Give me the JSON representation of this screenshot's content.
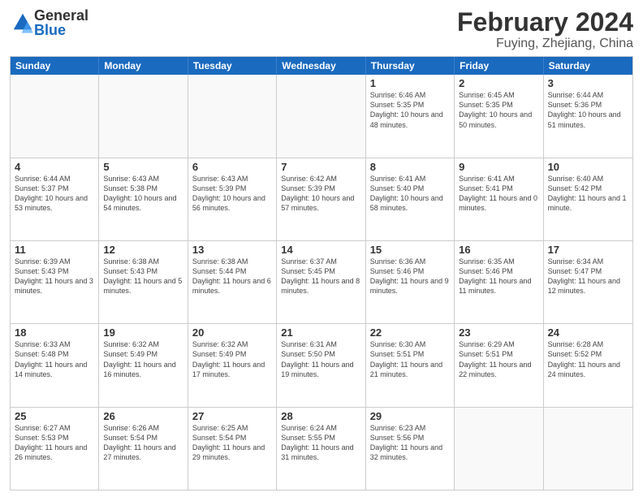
{
  "header": {
    "logo": {
      "general": "General",
      "blue": "Blue"
    },
    "title": "February 2024",
    "location": "Fuying, Zhejiang, China"
  },
  "weekdays": [
    "Sunday",
    "Monday",
    "Tuesday",
    "Wednesday",
    "Thursday",
    "Friday",
    "Saturday"
  ],
  "rows": [
    [
      {
        "day": "",
        "info": ""
      },
      {
        "day": "",
        "info": ""
      },
      {
        "day": "",
        "info": ""
      },
      {
        "day": "",
        "info": ""
      },
      {
        "day": "1",
        "info": "Sunrise: 6:46 AM\nSunset: 5:35 PM\nDaylight: 10 hours\nand 48 minutes."
      },
      {
        "day": "2",
        "info": "Sunrise: 6:45 AM\nSunset: 5:35 PM\nDaylight: 10 hours\nand 50 minutes."
      },
      {
        "day": "3",
        "info": "Sunrise: 6:44 AM\nSunset: 5:36 PM\nDaylight: 10 hours\nand 51 minutes."
      }
    ],
    [
      {
        "day": "4",
        "info": "Sunrise: 6:44 AM\nSunset: 5:37 PM\nDaylight: 10 hours\nand 53 minutes."
      },
      {
        "day": "5",
        "info": "Sunrise: 6:43 AM\nSunset: 5:38 PM\nDaylight: 10 hours\nand 54 minutes."
      },
      {
        "day": "6",
        "info": "Sunrise: 6:43 AM\nSunset: 5:39 PM\nDaylight: 10 hours\nand 56 minutes."
      },
      {
        "day": "7",
        "info": "Sunrise: 6:42 AM\nSunset: 5:39 PM\nDaylight: 10 hours\nand 57 minutes."
      },
      {
        "day": "8",
        "info": "Sunrise: 6:41 AM\nSunset: 5:40 PM\nDaylight: 10 hours\nand 58 minutes."
      },
      {
        "day": "9",
        "info": "Sunrise: 6:41 AM\nSunset: 5:41 PM\nDaylight: 11 hours\nand 0 minutes."
      },
      {
        "day": "10",
        "info": "Sunrise: 6:40 AM\nSunset: 5:42 PM\nDaylight: 11 hours\nand 1 minute."
      }
    ],
    [
      {
        "day": "11",
        "info": "Sunrise: 6:39 AM\nSunset: 5:43 PM\nDaylight: 11 hours\nand 3 minutes."
      },
      {
        "day": "12",
        "info": "Sunrise: 6:38 AM\nSunset: 5:43 PM\nDaylight: 11 hours\nand 5 minutes."
      },
      {
        "day": "13",
        "info": "Sunrise: 6:38 AM\nSunset: 5:44 PM\nDaylight: 11 hours\nand 6 minutes."
      },
      {
        "day": "14",
        "info": "Sunrise: 6:37 AM\nSunset: 5:45 PM\nDaylight: 11 hours\nand 8 minutes."
      },
      {
        "day": "15",
        "info": "Sunrise: 6:36 AM\nSunset: 5:46 PM\nDaylight: 11 hours\nand 9 minutes."
      },
      {
        "day": "16",
        "info": "Sunrise: 6:35 AM\nSunset: 5:46 PM\nDaylight: 11 hours\nand 11 minutes."
      },
      {
        "day": "17",
        "info": "Sunrise: 6:34 AM\nSunset: 5:47 PM\nDaylight: 11 hours\nand 12 minutes."
      }
    ],
    [
      {
        "day": "18",
        "info": "Sunrise: 6:33 AM\nSunset: 5:48 PM\nDaylight: 11 hours\nand 14 minutes."
      },
      {
        "day": "19",
        "info": "Sunrise: 6:32 AM\nSunset: 5:49 PM\nDaylight: 11 hours\nand 16 minutes."
      },
      {
        "day": "20",
        "info": "Sunrise: 6:32 AM\nSunset: 5:49 PM\nDaylight: 11 hours\nand 17 minutes."
      },
      {
        "day": "21",
        "info": "Sunrise: 6:31 AM\nSunset: 5:50 PM\nDaylight: 11 hours\nand 19 minutes."
      },
      {
        "day": "22",
        "info": "Sunrise: 6:30 AM\nSunset: 5:51 PM\nDaylight: 11 hours\nand 21 minutes."
      },
      {
        "day": "23",
        "info": "Sunrise: 6:29 AM\nSunset: 5:51 PM\nDaylight: 11 hours\nand 22 minutes."
      },
      {
        "day": "24",
        "info": "Sunrise: 6:28 AM\nSunset: 5:52 PM\nDaylight: 11 hours\nand 24 minutes."
      }
    ],
    [
      {
        "day": "25",
        "info": "Sunrise: 6:27 AM\nSunset: 5:53 PM\nDaylight: 11 hours\nand 26 minutes."
      },
      {
        "day": "26",
        "info": "Sunrise: 6:26 AM\nSunset: 5:54 PM\nDaylight: 11 hours\nand 27 minutes."
      },
      {
        "day": "27",
        "info": "Sunrise: 6:25 AM\nSunset: 5:54 PM\nDaylight: 11 hours\nand 29 minutes."
      },
      {
        "day": "28",
        "info": "Sunrise: 6:24 AM\nSunset: 5:55 PM\nDaylight: 11 hours\nand 31 minutes."
      },
      {
        "day": "29",
        "info": "Sunrise: 6:23 AM\nSunset: 5:56 PM\nDaylight: 11 hours\nand 32 minutes."
      },
      {
        "day": "",
        "info": ""
      },
      {
        "day": "",
        "info": ""
      }
    ]
  ]
}
